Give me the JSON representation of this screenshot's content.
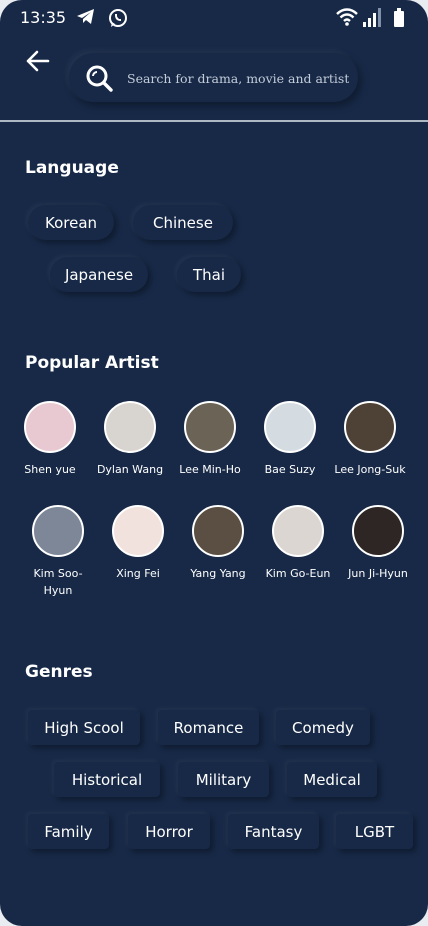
{
  "status_bar": {
    "time": "13:35",
    "icons": [
      "telegram-icon",
      "whatsapp-icon",
      "wifi-icon",
      "signal-icon",
      "battery-icon"
    ]
  },
  "header": {
    "back_icon": "arrow-left-icon",
    "search_icon": "search-icon",
    "search_placeholder": "Search for drama, movie and artist",
    "search_value": ""
  },
  "language": {
    "title": "Language",
    "options": [
      "Korean",
      "Chinese",
      "Japanese",
      "Thai"
    ]
  },
  "popular_artist": {
    "title": "Popular Artist",
    "artists": [
      {
        "name": "Shen yue",
        "avatar_color": "#e8c9d2"
      },
      {
        "name": "Dylan Wang",
        "avatar_color": "#d8d4cf"
      },
      {
        "name": "Lee Min-Ho",
        "avatar_color": "#6c6357"
      },
      {
        "name": "Bae Suzy",
        "avatar_color": "#d4dce2"
      },
      {
        "name": "Lee Jong-Suk",
        "avatar_color": "#4e4136"
      },
      {
        "name": "Kim Soo-Hyun",
        "avatar_color": "#7d8798"
      },
      {
        "name": "Xing Fei",
        "avatar_color": "#f1e2de"
      },
      {
        "name": "Yang Yang",
        "avatar_color": "#5b4f43"
      },
      {
        "name": "Kim Go-Eun",
        "avatar_color": "#dcd6d3"
      },
      {
        "name": "Jun Ji-Hyun",
        "avatar_color": "#2d2624"
      }
    ]
  },
  "genres": {
    "title": "Genres",
    "options": [
      "High Scool",
      "Romance",
      "Comedy",
      "Historical",
      "Military",
      "Medical",
      "Family",
      "Horror",
      "Fantasy",
      "LGBT"
    ]
  },
  "colors": {
    "background": "#172947",
    "text": "#ffffff",
    "divider": "#aeb7c4"
  }
}
